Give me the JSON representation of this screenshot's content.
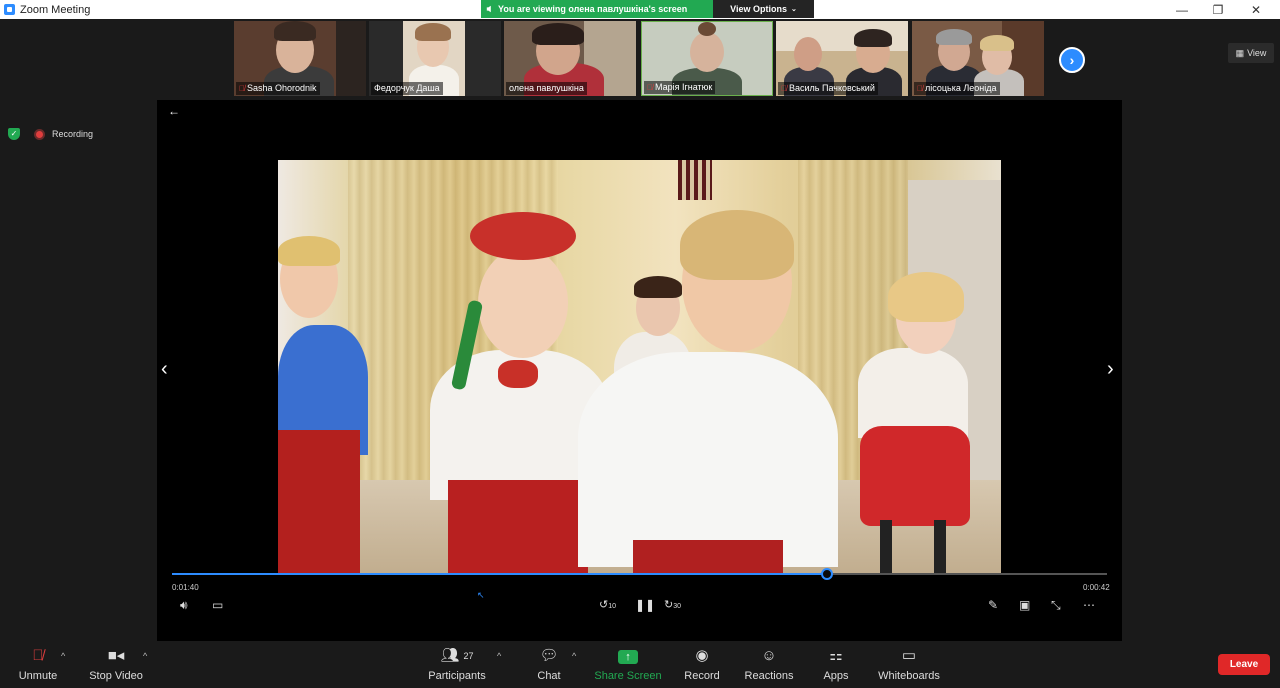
{
  "window": {
    "title": "Zoom Meeting",
    "minimize": "—",
    "maximize": "❐",
    "close": "✕"
  },
  "banner": {
    "text": "You are viewing олена павлушкіна's screen",
    "view_options": "View Options"
  },
  "view_button": "View",
  "recording": {
    "label": "Recording"
  },
  "participants_strip": [
    {
      "name": "Sasha Ohorodnik",
      "muted": true,
      "bg": "#6b4a3a"
    },
    {
      "name": "Федорчук Даша",
      "muted": false,
      "bg": "#d8c9b2"
    },
    {
      "name": "олена павлушкіна",
      "muted": false,
      "bg": "#8a7a6a"
    },
    {
      "name": "Марія Ігнатюк",
      "muted": true,
      "bg": "#c9cfc0"
    },
    {
      "name": "Василь Пачковський",
      "muted": true,
      "bg": "#c9b38f"
    },
    {
      "name": "лісоцька Леоніда",
      "muted": true,
      "bg": "#7a5a45"
    }
  ],
  "player": {
    "time_elapsed": "0:01:40",
    "time_remaining": "0:00:42",
    "progress": 0.7,
    "rewind_label": "10",
    "forward_label": "30"
  },
  "toolbar": {
    "unmute": "Unmute",
    "stop_video": "Stop Video",
    "participants": "Participants",
    "participants_count": "27",
    "chat": "Chat",
    "share_screen": "Share Screen",
    "record": "Record",
    "reactions": "Reactions",
    "apps": "Apps",
    "whiteboards": "Whiteboards",
    "leave": "Leave"
  },
  "colors": {
    "accent": "#2d8cff",
    "share_green": "#22a952",
    "leave_red": "#e02828"
  }
}
